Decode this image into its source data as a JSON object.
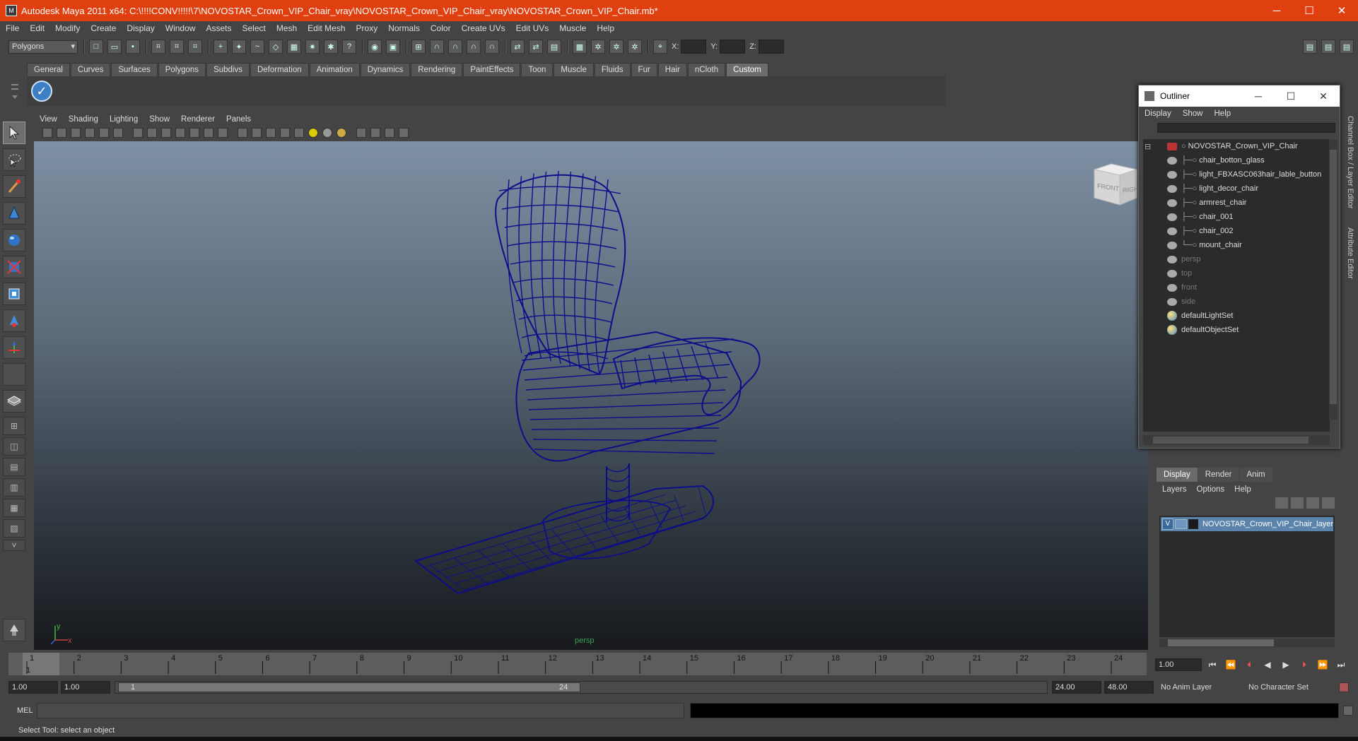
{
  "titlebar": {
    "title": "Autodesk Maya 2011 x64: C:\\!!!!CONV!!!!!\\7\\NOVOSTAR_Crown_VIP_Chair_vray\\NOVOSTAR_Crown_VIP_Chair_vray\\NOVOSTAR_Crown_VIP_Chair.mb*",
    "minimize": "─",
    "maximize": "☐",
    "close": "✕"
  },
  "menubar": {
    "items": [
      "File",
      "Edit",
      "Modify",
      "Create",
      "Display",
      "Window",
      "Assets",
      "Select",
      "Mesh",
      "Edit Mesh",
      "Proxy",
      "Normals",
      "Color",
      "Create UVs",
      "Edit UVs",
      "Muscle",
      "Help"
    ]
  },
  "statusline": {
    "mode": "Polygons",
    "x_label": "X:",
    "y_label": "Y:",
    "z_label": "Z:"
  },
  "shelf": {
    "tabs": [
      "General",
      "Curves",
      "Surfaces",
      "Polygons",
      "Subdivs",
      "Deformation",
      "Animation",
      "Dynamics",
      "Rendering",
      "PaintEffects",
      "Toon",
      "Muscle",
      "Fluids",
      "Fur",
      "Hair",
      "nCloth",
      "Custom"
    ],
    "active_tab": "Custom"
  },
  "viewport": {
    "menus": [
      "View",
      "Shading",
      "Lighting",
      "Show",
      "Renderer",
      "Panels"
    ],
    "camera_label": "persp",
    "viewcube_front": "FRONT",
    "viewcube_right": "RIGHT",
    "axis_y": "y",
    "axis_x": "x",
    "wire_color": "#0d0d8a"
  },
  "outliner": {
    "title": "Outliner",
    "menus": [
      "Display",
      "Show",
      "Help"
    ],
    "items": [
      {
        "label": "NOVOSTAR_Crown_VIP_Chair",
        "kind": "root"
      },
      {
        "label": "chair_botton_glass",
        "kind": "child"
      },
      {
        "label": "light_FBXASC063hair_lable_button",
        "kind": "child"
      },
      {
        "label": "light_decor_chair",
        "kind": "child"
      },
      {
        "label": "armrest_chair",
        "kind": "child"
      },
      {
        "label": "chair_001",
        "kind": "child"
      },
      {
        "label": "chair_002",
        "kind": "child"
      },
      {
        "label": "mount_chair",
        "kind": "child"
      },
      {
        "label": "persp",
        "kind": "camera"
      },
      {
        "label": "top",
        "kind": "camera"
      },
      {
        "label": "front",
        "kind": "camera"
      },
      {
        "label": "side",
        "kind": "camera"
      },
      {
        "label": "defaultLightSet",
        "kind": "set"
      },
      {
        "label": "defaultObjectSet",
        "kind": "set"
      }
    ]
  },
  "side_tabs": {
    "channel_box": "Channel Box / Layer Editor",
    "attribute_editor": "Attribute Editor"
  },
  "layer_editor": {
    "tabs": [
      "Display",
      "Render",
      "Anim"
    ],
    "active_tab": "Display",
    "menus": [
      "Layers",
      "Options",
      "Help"
    ],
    "layer_visible": "V",
    "layer_name": "NOVOSTAR_Crown_VIP_Chair_layer"
  },
  "timeslider": {
    "ticks": [
      "1",
      "2",
      "3",
      "4",
      "5",
      "6",
      "7",
      "8",
      "9",
      "10",
      "11",
      "12",
      "13",
      "14",
      "15",
      "16",
      "17",
      "18",
      "19",
      "20",
      "21",
      "22",
      "23",
      "24"
    ],
    "current_frame": "1",
    "current_time": "1.00"
  },
  "range": {
    "start": "1.00",
    "playback_start": "1.00",
    "knob_start": "1",
    "knob_end": "24",
    "playback_end": "24.00",
    "end": "48.00",
    "anim_layer": "No Anim Layer",
    "char_set": "No Character Set"
  },
  "playback": [
    "⏮",
    "⏪",
    "⏴",
    "◀",
    "▶",
    "⏵",
    "⏩",
    "⏭"
  ],
  "cmdline": {
    "label": "MEL"
  },
  "helpline": {
    "text": "Select Tool: select an object"
  }
}
